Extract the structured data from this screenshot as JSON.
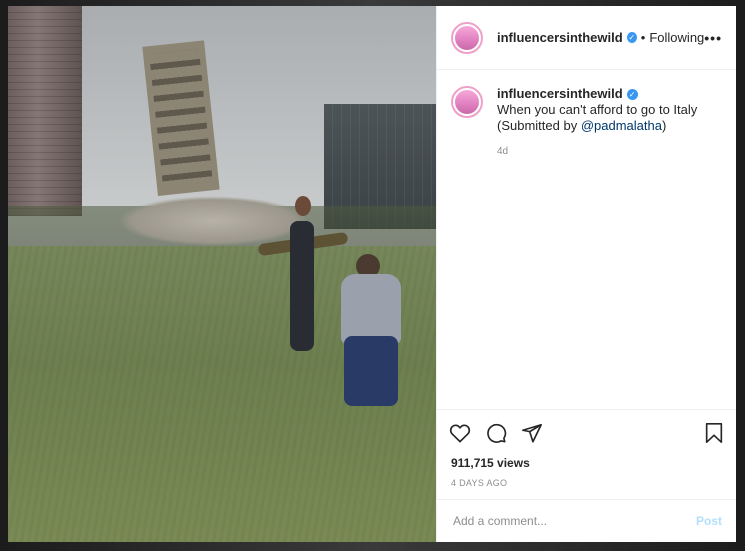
{
  "post": {
    "username": "influencersinthewild",
    "follow_separator": "•",
    "follow_label": "Following",
    "more_label": "•••",
    "caption_line1": "When you can't afford to go to Italy",
    "caption_prefix": "(Submitted by ",
    "caption_mention": "@padmalatha",
    "caption_suffix": ")",
    "posted_relative": "4d",
    "views": "911,715 views",
    "time_ago": "4 DAYS AGO"
  },
  "comment": {
    "placeholder": "Add a comment...",
    "post_label": "Post"
  },
  "icons": {
    "like": "heart-icon",
    "comment": "comment-icon",
    "share": "share-icon",
    "save": "bookmark-icon",
    "verified": "verified-badge-icon",
    "more": "more-options-icon"
  },
  "colors": {
    "verified": "#3897f0",
    "post_button_disabled": "#b2dffc",
    "mention": "#00376b"
  }
}
